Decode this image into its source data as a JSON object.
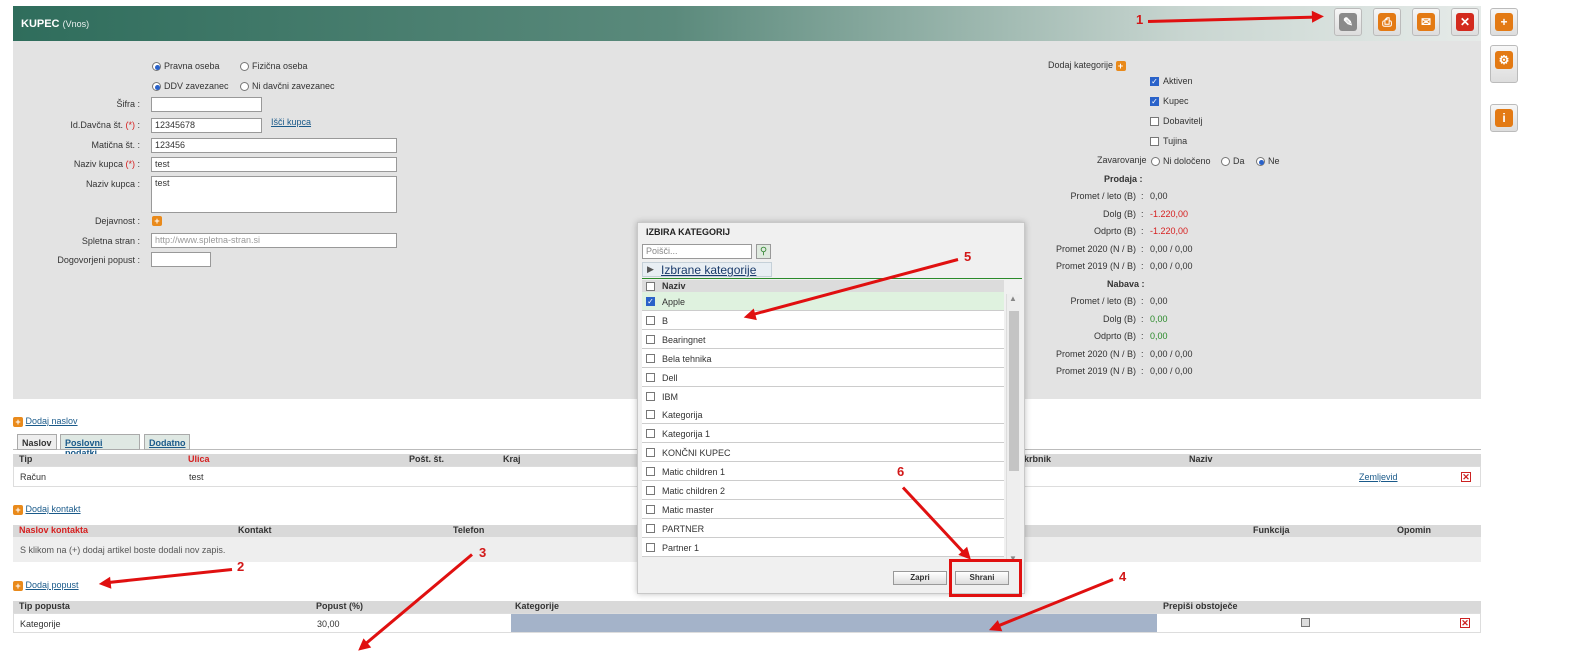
{
  "header": {
    "title": "KUPEC",
    "subtitle": "(Vnos)"
  },
  "toolbar": {
    "icons": [
      "pencil-icon",
      "print-icon",
      "mail-icon",
      "close-icon",
      "plus-icon"
    ]
  },
  "form": {
    "radio_pravna": "Pravna oseba",
    "radio_fizicna": "Fizična oseba",
    "radio_ddv": "DDV zavezanec",
    "radio_ni_davcni": "Ni davčni zavezanec",
    "sifra_label": "Šifra",
    "davcna_label": "Id.Davčna št.",
    "davcna_value": "12345678",
    "isci_kupca": "Išči kupca",
    "maticna_label": "Matična št.",
    "maticna_value": "123456",
    "naziv_label": "Naziv kupca",
    "naziv_value": "test",
    "naziv2_label": "Naziv kupca",
    "naziv2_value": "test",
    "dejavnost_label": "Dejavnost",
    "spletna_label": "Spletna stran",
    "spletna_placeholder": "http://www.spletna-stran.si",
    "popust_label": "Dogovorjeni popust",
    "required": "(*)",
    "colon": ":"
  },
  "right": {
    "dodaj_kategorije": "Dodaj kategorije",
    "aktiven": "Aktiven",
    "kupec": "Kupec",
    "dobavitelj": "Dobavitelj",
    "tujina": "Tujina",
    "zavarovanje_label": "Zavarovanje",
    "ni_doloceno": "Ni določeno",
    "da": "Da",
    "ne": "Ne",
    "prodaja": "Prodaja",
    "nabava": "Nabava",
    "prodaja_rows": [
      {
        "label": "Promet / leto (B)",
        "value": "0,00",
        "color": "normal"
      },
      {
        "label": "Dolg (B)",
        "value": "-1.220,00",
        "color": "red"
      },
      {
        "label": "Odprto (B)",
        "value": "-1.220,00",
        "color": "red"
      },
      {
        "label": "Promet 2020 (N / B)",
        "value": "0,00 / 0,00",
        "color": "normal"
      },
      {
        "label": "Promet 2019 (N / B)",
        "value": "0,00 / 0,00",
        "color": "normal"
      }
    ],
    "nabava_rows": [
      {
        "label": "Promet / leto (B)",
        "value": "0,00",
        "color": "normal"
      },
      {
        "label": "Dolg (B)",
        "value": "0,00",
        "color": "green"
      },
      {
        "label": "Odprto (B)",
        "value": "0,00",
        "color": "green"
      },
      {
        "label": "Promet 2020 (N / B)",
        "value": "0,00 / 0,00",
        "color": "normal"
      },
      {
        "label": "Promet 2019 (N / B)",
        "value": "0,00 / 0,00",
        "color": "normal"
      }
    ]
  },
  "naslov": {
    "dodaj": "Dodaj naslov",
    "tabs": [
      "Naslov",
      "Poslovni podatki",
      "Dodatno"
    ],
    "cols": [
      "Tip",
      "Ulica",
      "Pošt. št.",
      "Kraj",
      "Skrbnik",
      "Naziv"
    ],
    "row": {
      "tip": "Račun",
      "ulica": "test",
      "link": "Zemljevid"
    }
  },
  "kontakt": {
    "dodaj": "Dodaj kontakt",
    "cols": [
      "Naslov kontakta",
      "Kontakt",
      "Telefon",
      "Funkcija",
      "Opomin"
    ],
    "empty": "S klikom na (+) dodaj artikel boste dodali nov zapis."
  },
  "popust": {
    "dodaj": "Dodaj popust",
    "cols": [
      "Tip popusta",
      "Popust (%)",
      "Kategorije",
      "Prepiši obstoječe"
    ],
    "row": {
      "tip": "Kategorije",
      "popust": "30,00"
    }
  },
  "modal": {
    "title": "IZBIRA KATEGORIJ",
    "search_placeholder": "Poišči...",
    "selected_link": "Izbrane kategorije",
    "col_naziv": "Naziv",
    "items": [
      {
        "name": "Apple",
        "checked": true
      },
      {
        "name": "B",
        "checked": false
      },
      {
        "name": "Bearingnet",
        "checked": false
      },
      {
        "name": "Bela tehnika",
        "checked": false
      },
      {
        "name": "Dell",
        "checked": false
      },
      {
        "name": "IBM",
        "checked": false
      },
      {
        "name": "Kategorija",
        "checked": false
      },
      {
        "name": "Kategorija 1",
        "checked": false
      },
      {
        "name": "KONČNI KUPEC",
        "checked": false
      },
      {
        "name": "Matic children 1",
        "checked": false
      },
      {
        "name": "Matic children 2",
        "checked": false
      },
      {
        "name": "Matic master",
        "checked": false
      },
      {
        "name": "PARTNER",
        "checked": false
      },
      {
        "name": "Partner 1",
        "checked": false
      }
    ],
    "close_btn": "Zapri",
    "save_btn": "Shrani"
  },
  "annotations": [
    "1",
    "2",
    "3",
    "4",
    "5",
    "6"
  ]
}
